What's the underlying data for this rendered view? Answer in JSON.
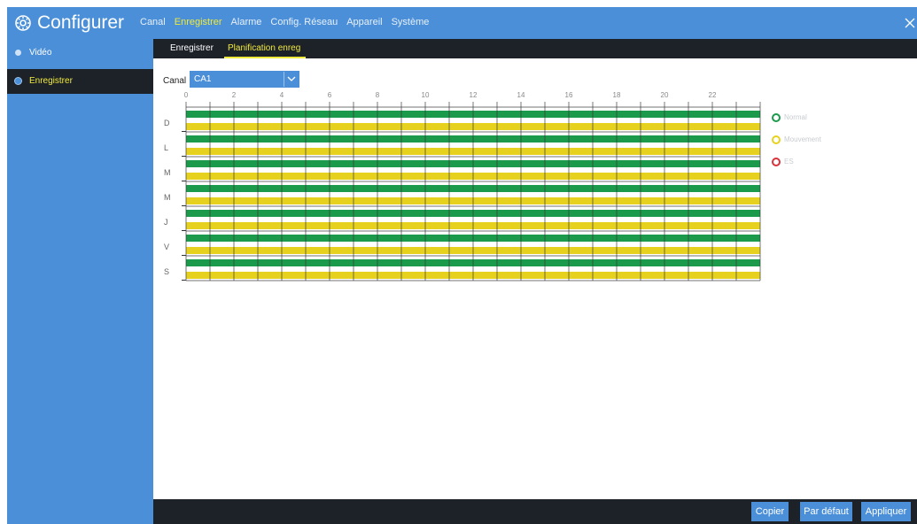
{
  "header": {
    "title": "Configurer",
    "tabs": [
      {
        "label": "Canal",
        "active": false
      },
      {
        "label": "Enregistrer",
        "active": true
      },
      {
        "label": "Alarme",
        "active": false
      },
      {
        "label": "Config. Réseau",
        "active": false
      },
      {
        "label": "Appareil",
        "active": false
      },
      {
        "label": "Système",
        "active": false
      }
    ],
    "logo_icon": "gear-icon",
    "close_icon": "close-icon"
  },
  "sidebar": {
    "items": [
      {
        "label": "Vidéo",
        "active": false
      },
      {
        "label": "Enregistrer",
        "active": true
      }
    ]
  },
  "subtabs": [
    {
      "label": "Enregistrer",
      "active": false
    },
    {
      "label": "Planification enreg",
      "active": true
    }
  ],
  "schedule": {
    "canal_label": "Canal",
    "canal_value": "CA1",
    "hour_labels": [
      "0",
      "2",
      "4",
      "6",
      "8",
      "10",
      "12",
      "14",
      "16",
      "18",
      "20",
      "22"
    ],
    "days": [
      "D",
      "L",
      "M",
      "M",
      "J",
      "V",
      "S"
    ],
    "hours_per_day": 24,
    "recording_layers": [
      "Normal",
      "Mouvement"
    ],
    "legend": [
      {
        "label": "Normal",
        "color": "#1a9a4a"
      },
      {
        "label": "Mouvement",
        "color": "#e6d21e"
      },
      {
        "label": "ES",
        "color": "#d8323c"
      }
    ]
  },
  "footer": {
    "copy_label": "Copier",
    "default_label": "Par défaut",
    "apply_label": "Appliquer"
  },
  "colors": {
    "accent_blue": "#4a8fd8",
    "dark_bar": "#1d2128",
    "active_yellow": "#f0ea3c",
    "normal_green": "#1a9a4a",
    "motion_yellow": "#e6d21e"
  }
}
